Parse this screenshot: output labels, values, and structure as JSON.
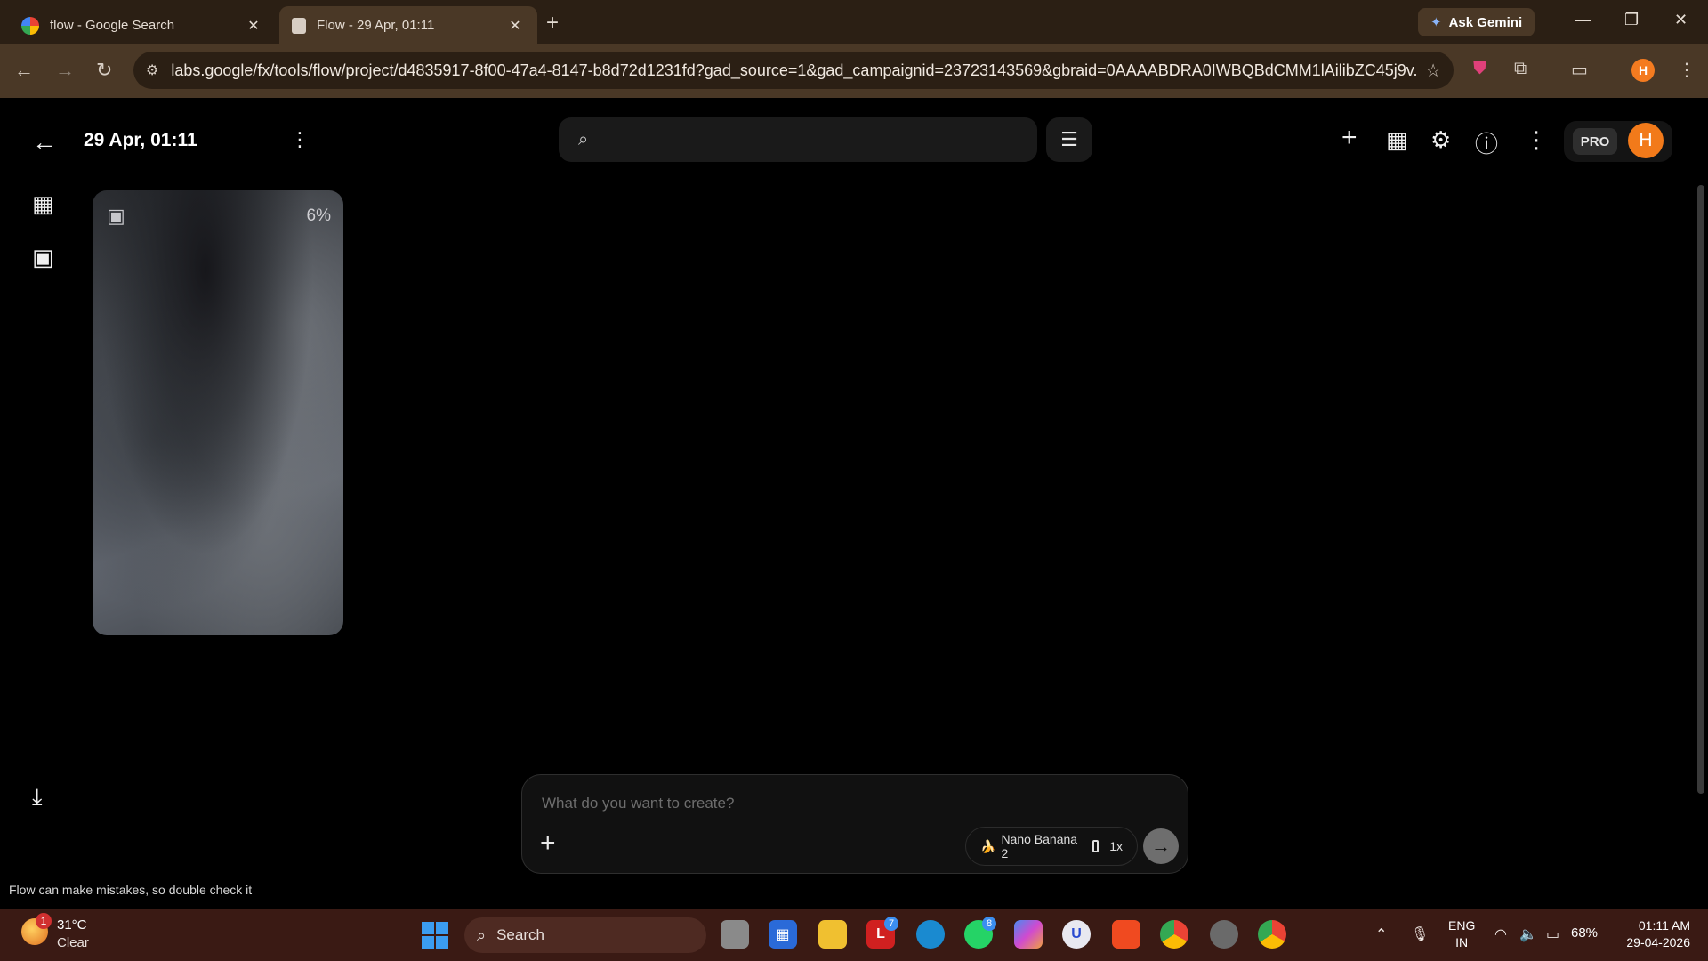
{
  "browser": {
    "tabs": [
      {
        "title": "flow - Google Search",
        "active": false
      },
      {
        "title": "Flow - 29 Apr, 01:11",
        "active": true
      }
    ],
    "new_tab_icon": "+",
    "ask_gemini": "Ask Gemini",
    "url": "labs.google/fx/tools/flow/project/d4835917-8f00-47a4-8147-b8d72d1231fd?gad_source=1&gad_campaignid=23723143569&gbraid=0AAAABDRA0IWBQBdCMM1lAilibZC45j9v...",
    "profile_initial": "H"
  },
  "app": {
    "project_title": "29 Apr, 01:11",
    "search_placeholder": "",
    "pro_label": "PRO",
    "avatar_initial": "H",
    "generation": {
      "progress_label": "6%",
      "progress": 0.06
    },
    "prompt": {
      "placeholder": "What do you want to create?",
      "model_name": "Nano Banana 2",
      "count": "1x"
    },
    "disclaimer": "Flow can make mistakes, so double check it"
  },
  "taskbar": {
    "weather_badge": "1",
    "temperature": "31°C",
    "condition": "Clear",
    "search_label": "Search",
    "badges": {
      "l_app": "7",
      "whatsapp": "8"
    },
    "lang_line1": "ENG",
    "lang_line2": "IN",
    "battery": "68%",
    "time": "01:11 AM",
    "date": "29-04-2026"
  },
  "colors": {
    "accent_orange": "#f27a1a",
    "chrome_brown": "#4a3826",
    "taskbar": "#3a1a14"
  }
}
